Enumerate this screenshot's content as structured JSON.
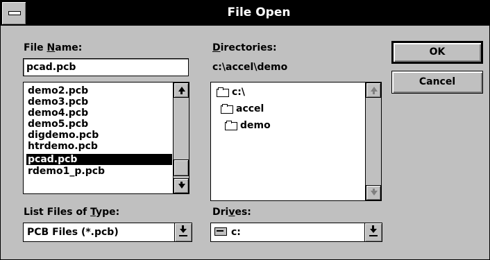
{
  "window": {
    "title": "File Open"
  },
  "file_name": {
    "label_pre": "File ",
    "label_hot": "N",
    "label_post": "ame:",
    "value": "pcad.pcb",
    "list": [
      {
        "name": "demo2.pcb"
      },
      {
        "name": "demo3.pcb"
      },
      {
        "name": "demo4.pcb"
      },
      {
        "name": "demo5.pcb"
      },
      {
        "name": "digdemo.pcb"
      },
      {
        "name": "htrdemo.pcb"
      },
      {
        "name": "pcad.pcb"
      },
      {
        "name": "rdemo1_p.pcb"
      }
    ],
    "selected": "pcad.pcb"
  },
  "directories": {
    "label_pre": "",
    "label_hot": "D",
    "label_post": "irectories:",
    "current_path": "c:\\accel\\demo",
    "tree": [
      {
        "name": "c:\\"
      },
      {
        "name": "accel"
      },
      {
        "name": "demo"
      }
    ]
  },
  "file_type": {
    "label_pre": "List Files of ",
    "label_hot": "T",
    "label_post": "ype:",
    "value": "PCB Files (*.pcb)"
  },
  "drives": {
    "label_pre": "Dri",
    "label_hot": "v",
    "label_post": "es:",
    "value": "c:"
  },
  "buttons": {
    "ok": "OK",
    "cancel": "Cancel"
  },
  "colors": {
    "face": "#c0c0c0",
    "titlebar": "#000000",
    "selection": "#000000"
  }
}
